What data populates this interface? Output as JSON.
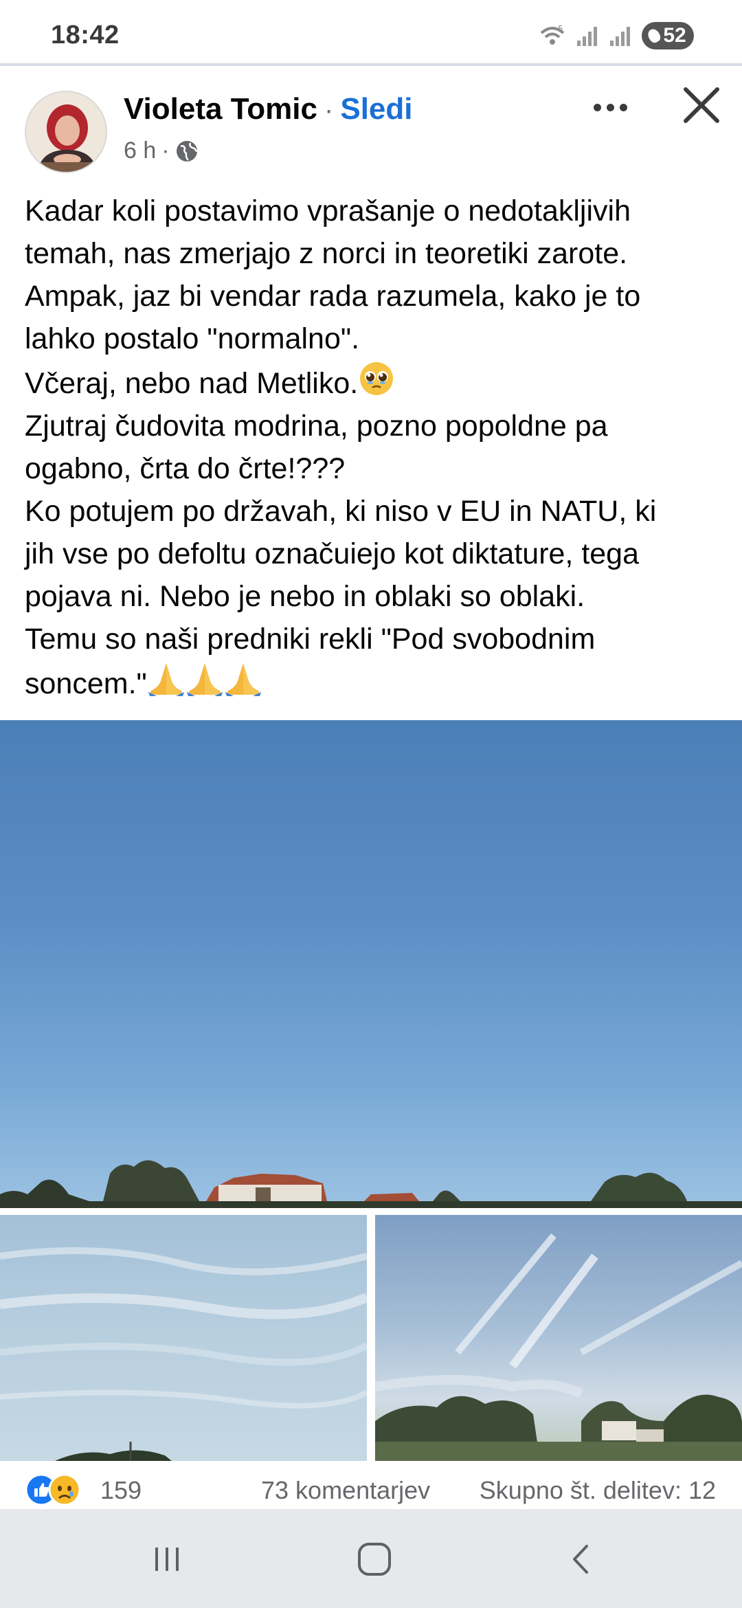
{
  "status_bar": {
    "time": "18:42",
    "battery_level": "52",
    "icons": [
      "wifi-icon",
      "signal-icon",
      "signal-icon",
      "battery-icon"
    ]
  },
  "post": {
    "author": "Violeta Tomic",
    "separator": "·",
    "follow_label": "Sledi",
    "time": "6 h",
    "meta_separator": "·",
    "audience_icon": "globe-icon",
    "text_lines": [
      "Kadar koli postavimo vprašanje o nedotakljivih",
      "temah, nas zmerjajo z norci in teoretiki zarote.",
      "Ampak, jaz bi vendar rada razumela, kako je to",
      "lahko postalo \"normalno\".",
      "Včeraj, nebo nad Metliko.",
      " Zjutraj čudovita modrina, pozno popoldne pa",
      "ogabno, črta do črte!???",
      "Ko potujem po državah, ki niso v EU in NATU, ki",
      "jih vse po defoltu označuiejo kot diktature, tega",
      "pojava ni. Nebo je nebo in oblaki so oblaki.",
      "Temu so naši predniki rekli \"Pod svobodnim",
      "soncem.\""
    ],
    "emoji": {
      "pleading": "pleading-face-emoji",
      "praying": "folded-hands-emoji"
    }
  },
  "reactions": {
    "icons": [
      "like-icon",
      "sad-icon"
    ],
    "count": "159",
    "comments": "73 komentarjev",
    "shares": "Skupno št. delitev: 12"
  },
  "nav_bar": {
    "icons": [
      "recent-apps-icon",
      "home-icon",
      "back-icon"
    ]
  },
  "colors": {
    "accent": "#1b6fd6",
    "secondary_text": "#65676b",
    "nav_bg": "#e7e8ec"
  }
}
